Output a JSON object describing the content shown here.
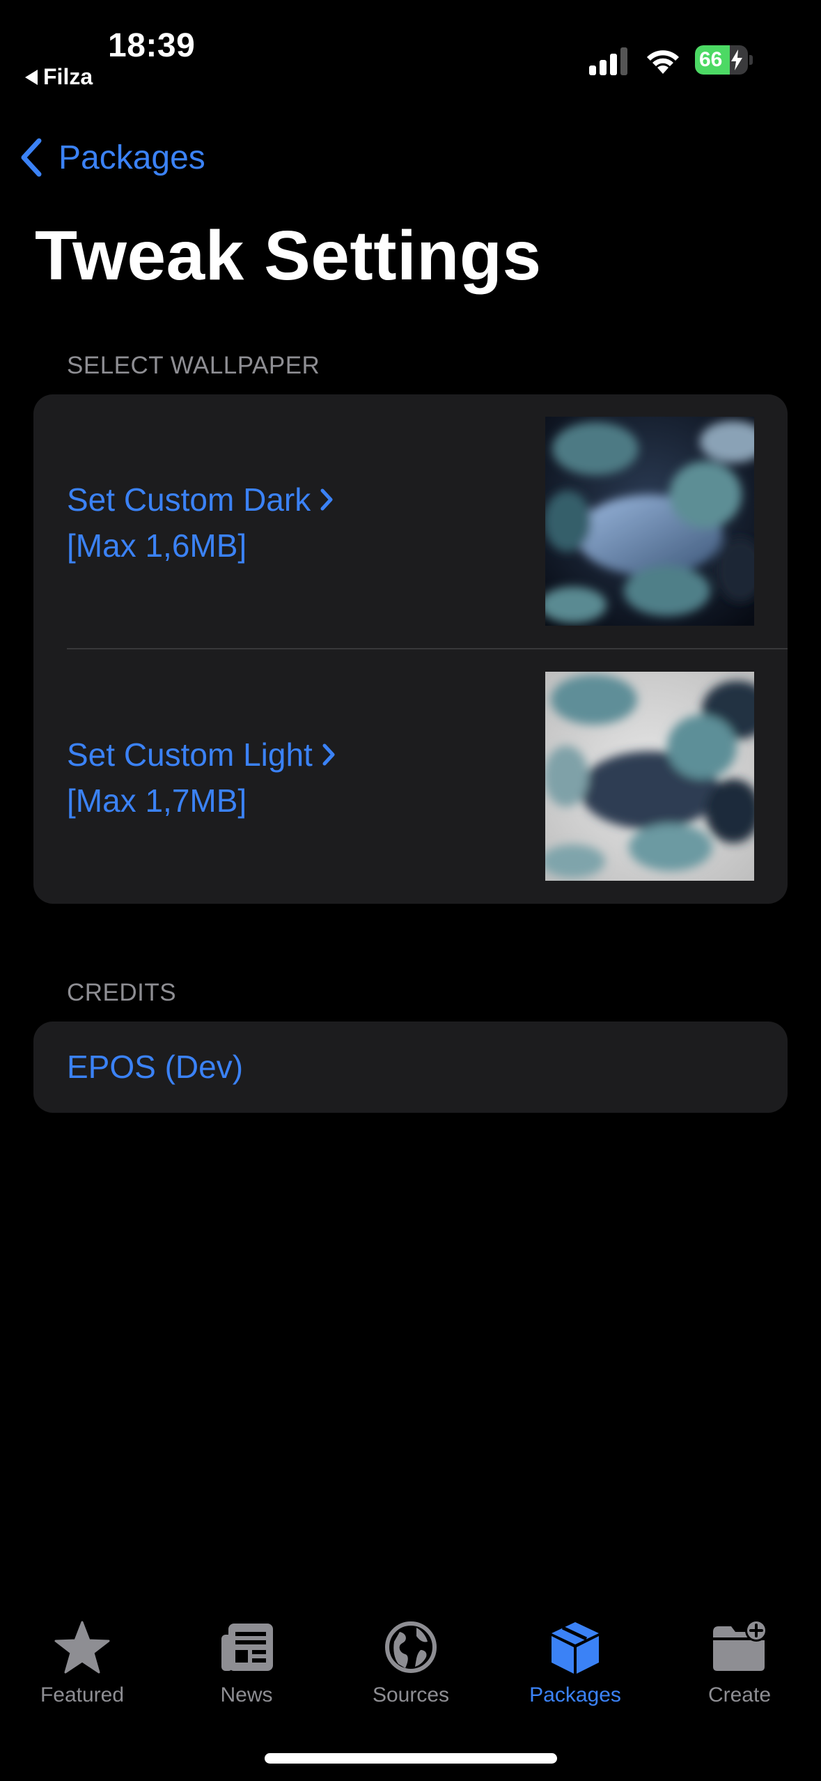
{
  "status_bar": {
    "time": "18:39",
    "back_app": "Filza",
    "battery_level": "66",
    "battery_percent": 66,
    "icons": [
      "signal-icon",
      "wifi-icon",
      "battery-icon",
      "charging-bolt-icon"
    ]
  },
  "nav": {
    "back_label": "Packages",
    "title": "Tweak Settings"
  },
  "wallpaper_section": {
    "header": "SELECT WALLPAPER",
    "items": [
      {
        "label": "Set Custom Dark",
        "sublabel": "[Max 1,6MB]",
        "thumbnail": "dark"
      },
      {
        "label": "Set Custom Light",
        "sublabel": "[Max 1,7MB]",
        "thumbnail": "light"
      }
    ]
  },
  "credits_section": {
    "header": "CREDITS",
    "items": [
      {
        "label": "EPOS (Dev)"
      }
    ]
  },
  "tabbar": {
    "tabs": [
      {
        "label": "Featured",
        "icon": "star-icon",
        "active": false
      },
      {
        "label": "News",
        "icon": "newspaper-icon",
        "active": false
      },
      {
        "label": "Sources",
        "icon": "globe-icon",
        "active": false
      },
      {
        "label": "Packages",
        "icon": "package-icon",
        "active": true
      },
      {
        "label": "Create",
        "icon": "folder-add-icon",
        "active": false
      }
    ]
  },
  "colors": {
    "accent": "#3b82f6",
    "background": "#000000",
    "group_background": "#1c1c1e",
    "secondary_text": "#8e8e93",
    "battery_fill": "#4cd964"
  }
}
